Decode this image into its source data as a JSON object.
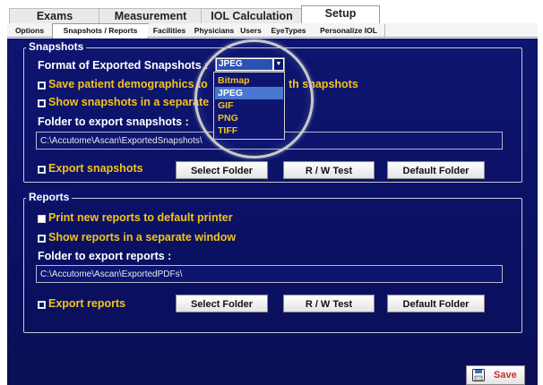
{
  "top_tabs": [
    {
      "label": "Exams",
      "active": false
    },
    {
      "label": "Measurement",
      "active": false
    },
    {
      "label": "IOL Calculation",
      "active": false
    },
    {
      "label": "Setup",
      "active": true
    }
  ],
  "sub_tabs": [
    {
      "label": "Options",
      "active": false
    },
    {
      "label": "Snapshots / Reports",
      "active": true
    },
    {
      "label": "Facilities",
      "active": false
    },
    {
      "label": "Physicians",
      "active": false
    },
    {
      "label": "Users",
      "active": false
    },
    {
      "label": "EyeTypes",
      "active": false
    },
    {
      "label": "Personalize IOL",
      "active": false
    }
  ],
  "snapshots": {
    "legend": "Snapshots",
    "format_label": "Format of Exported Snapshots :",
    "format_value": "JPEG",
    "format_options": [
      "Bitmap",
      "JPEG",
      "GIF",
      "PNG",
      "TIFF"
    ],
    "save_demographics": {
      "label": "Save patient demographics to",
      "label_tail": "th snapshots",
      "checked": true
    },
    "show_separate": {
      "label": "Show snapshots in a separate",
      "checked": true
    },
    "folder_label": "Folder to export snapshots :",
    "folder_path": "C:\\Accutome\\Ascan\\ExportedSnapshots\\",
    "export": {
      "label": "Export snapshots",
      "checked": true
    },
    "select_folder": "Select Folder",
    "rw_test": "R / W Test",
    "default_folder": "Default Folder"
  },
  "reports": {
    "legend": "Reports",
    "print_default": {
      "label": "Print new reports to default printer",
      "checked": false
    },
    "show_separate": {
      "label": "Show reports in a separate window",
      "checked": true
    },
    "folder_label": "Folder to export reports :",
    "folder_path": "C:\\Accutome\\Ascan\\ExportedPDFs\\",
    "export": {
      "label": "Export reports",
      "checked": true
    },
    "select_folder": "Select Folder",
    "rw_test": "R / W Test",
    "default_folder": "Default Folder"
  },
  "save_button": {
    "label": "Save",
    "icon": "save-icon"
  },
  "colors": {
    "panel": "#0d1570",
    "accent_yellow": "#f4c31a",
    "selection_blue": "#4a78d0",
    "save_red": "#cf2b2b"
  }
}
